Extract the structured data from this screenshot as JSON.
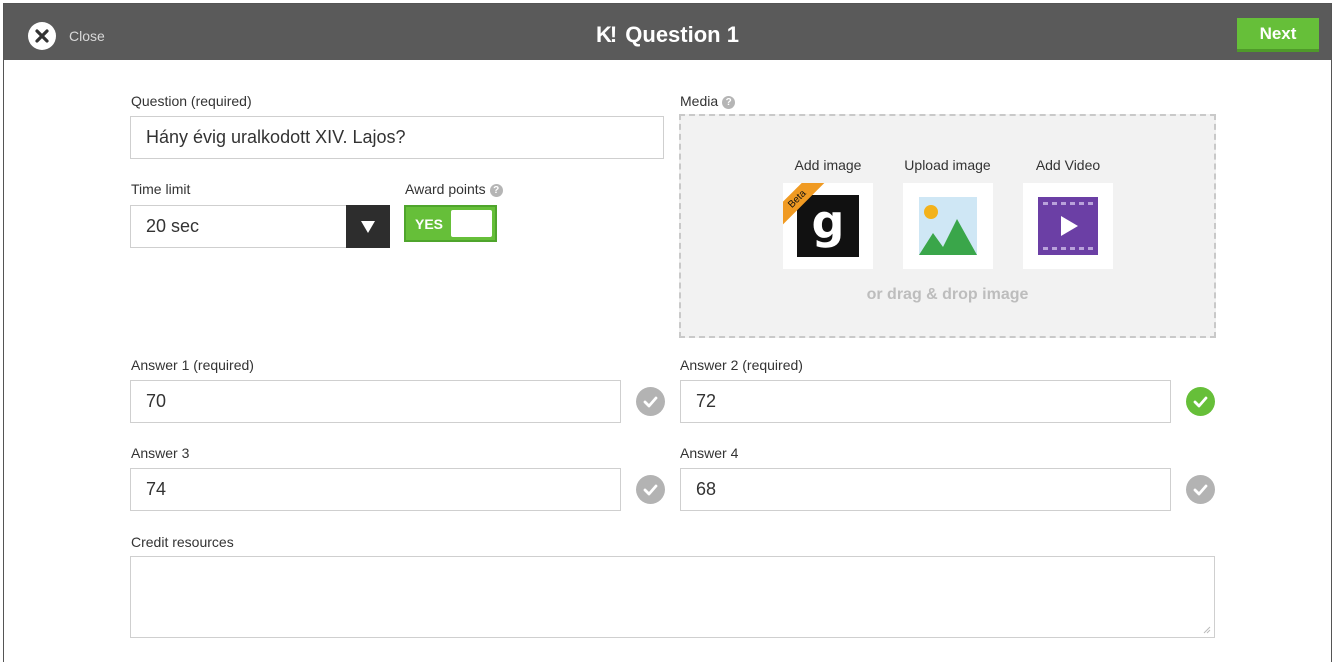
{
  "header": {
    "close_label": "Close",
    "title": "Question 1",
    "next_label": "Next",
    "accent_color": "#66bf39"
  },
  "question": {
    "label": "Question (required)",
    "value": "Hány évig uralkodott XIV. Lajos?"
  },
  "time_limit": {
    "label": "Time limit",
    "value": "20 sec"
  },
  "award_points": {
    "label": "Award points",
    "toggle_label": "YES",
    "enabled": true
  },
  "media": {
    "label": "Media",
    "options": [
      {
        "label": "Add image",
        "badge": "Beta",
        "icon": "getty-g-icon"
      },
      {
        "label": "Upload image",
        "icon": "landscape-image-icon"
      },
      {
        "label": "Add Video",
        "icon": "video-play-icon"
      }
    ],
    "drag_text": "or drag & drop image"
  },
  "answers": [
    {
      "label": "Answer 1 (required)",
      "value": "70",
      "correct": false
    },
    {
      "label": "Answer 2 (required)",
      "value": "72",
      "correct": true
    },
    {
      "label": "Answer 3",
      "value": "74",
      "correct": false
    },
    {
      "label": "Answer 4",
      "value": "68",
      "correct": false
    }
  ],
  "credit": {
    "label": "Credit resources",
    "value": ""
  }
}
